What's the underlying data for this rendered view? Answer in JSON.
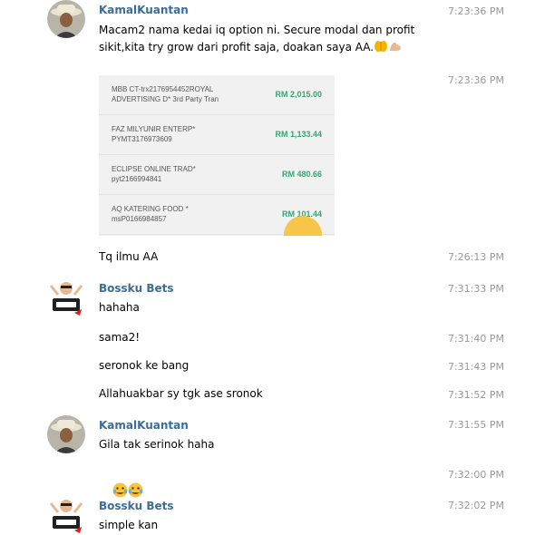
{
  "messages": [
    {
      "sender": "KamalKuantan",
      "text": "Macam2 nama kedai iq option ni. Secure modal dan profit\nsikit,kita try grow dari profit saja, doakan saya AA.",
      "emojis": [
        "pray-hands",
        "flexed-biceps"
      ],
      "time": "7:23:36 PM"
    },
    {
      "image_time": "7:23:36 PM",
      "transactions": [
        {
          "desc": "MBB CT-trx2176954452ROYAL\nADVERTISING D* 3rd Party Tran",
          "amount": "RM 2,015.00"
        },
        {
          "desc": "FAZ MILYUNIR ENTERP*\nPYMT3176973609",
          "amount": "RM 1,133.44"
        },
        {
          "desc": "ECLIPSE ONLINE TRAD*\npyt2166994841",
          "amount": "RM 480.66"
        },
        {
          "desc": "AQ KATERING FOOD *\nmsP0166984857",
          "amount": "RM 101.44"
        }
      ]
    },
    {
      "text": "Tq ilmu AA",
      "time": "7:26:13 PM"
    },
    {
      "sender": "Bossku Bets",
      "text": "hahaha",
      "time": "7:31:33 PM"
    },
    {
      "text": "sama2!",
      "time": "7:31:40 PM"
    },
    {
      "text": "seronok ke bang",
      "time": "7:31:43 PM"
    },
    {
      "text": "Allahuakbar sy tgk ase sronok",
      "time": "7:31:52 PM"
    },
    {
      "sender": "KamalKuantan",
      "text": "Gila tak serinok haha",
      "time": "7:31:55 PM"
    },
    {
      "emojis": [
        "face-with-tears-of-joy",
        "face-with-tears-of-joy"
      ],
      "time": "7:32:00 PM"
    },
    {
      "sender": "Bossku Bets",
      "text": "simple kan",
      "time": "7:32:02 PM"
    }
  ],
  "colors": {
    "sender_name": "#3a6d99",
    "timestamp": "#999999",
    "amount": "#3aa374"
  }
}
